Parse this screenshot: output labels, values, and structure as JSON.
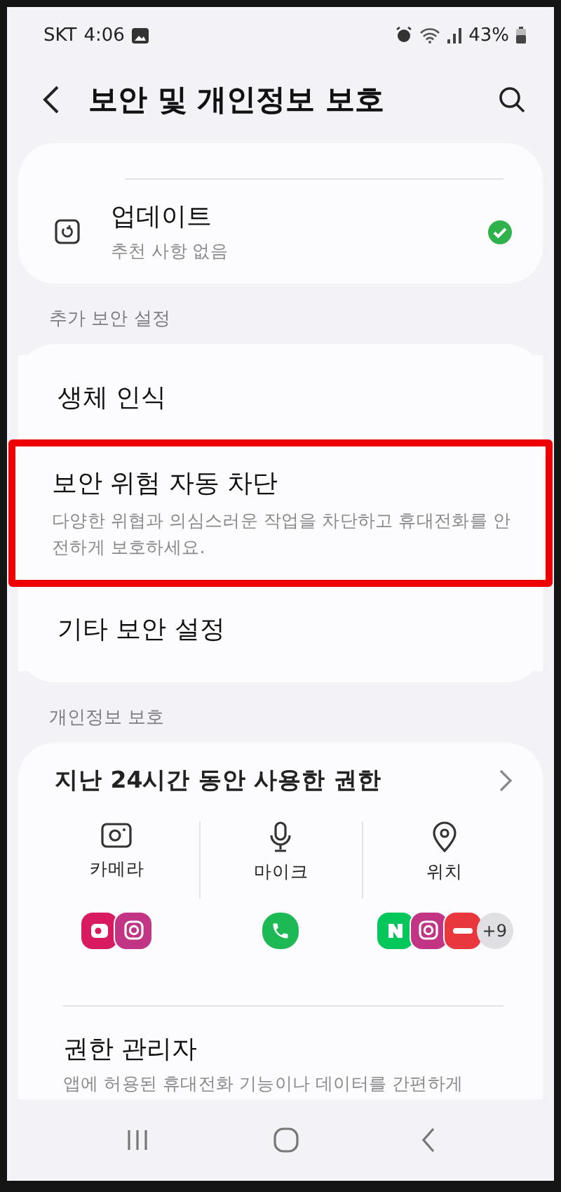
{
  "status_bar": {
    "carrier": "SKT",
    "time": "4:06",
    "battery": "43%"
  },
  "header": {
    "title": "보안 및 개인정보 보호"
  },
  "top_card": {
    "items": [
      {
        "title": "업데이트",
        "subtitle": "추천 사항 없음",
        "done": true
      }
    ]
  },
  "sections": [
    {
      "header": "추가 보안 설정",
      "items": [
        {
          "title": "생체 인식",
          "highlighted": false
        },
        {
          "title": "보안 위험 자동 차단",
          "subtitle": "다양한 위협과 의심스러운 작업을 차단하고 휴대전화를 안전하게 보호하세요.",
          "highlighted": true
        },
        {
          "title": "기타 보안 설정",
          "highlighted": false
        }
      ]
    },
    {
      "header": "개인정보 보호"
    }
  ],
  "permissions": {
    "title": "지난 24시간 동안 사용한 권한",
    "columns": [
      {
        "label": "카메라",
        "kind": "camera",
        "apps": [
          {
            "kind": "camera",
            "color": "#d81b60"
          },
          {
            "kind": "instagram",
            "color": "#c13584"
          }
        ]
      },
      {
        "label": "마이크",
        "kind": "mic",
        "apps": [
          {
            "kind": "phone",
            "color": "#1db954"
          }
        ]
      },
      {
        "label": "위치",
        "kind": "location",
        "apps": [
          {
            "kind": "naver",
            "color": "#03c75a"
          },
          {
            "kind": "instagram",
            "color": "#c13584"
          },
          {
            "kind": "pass",
            "color": "#e8383d"
          }
        ],
        "more": "+9"
      }
    ]
  },
  "manager": {
    "title": "권한 관리자",
    "subtitle": "앱에 허용된 휴대전화 기능이나 데이터를 간편하게"
  }
}
